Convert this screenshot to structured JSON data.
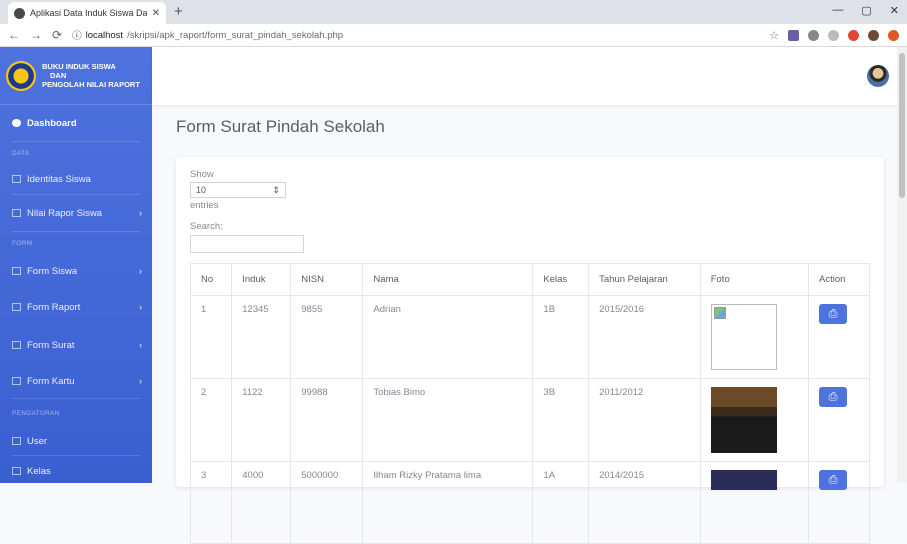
{
  "browser": {
    "tab_title": "Aplikasi Data Induk Siswa Dan Ni",
    "url_host": "localhost",
    "url_path": "/skripsi/apk_raport/form_surat_pindah_sekolah.php"
  },
  "sidebar": {
    "brand_line1": "BUKU INDUK SISWA",
    "brand_line2": "DAN",
    "brand_line3": "PENGOLAH NILAI RAPORT",
    "dashboard": "Dashboard",
    "section_data": "DATA",
    "identitas": "Identitas Siswa",
    "nilai": "Nilai Rapor Siswa",
    "section_form": "FORM",
    "form_siswa": "Form Siswa",
    "form_raport": "Form Raport",
    "form_surat": "Form Surat",
    "form_kartu": "Form Kartu",
    "section_pengaturan": "PENGATURAN",
    "user": "User",
    "kelas": "Kelas"
  },
  "main": {
    "page_title": "Form Surat Pindah Sekolah",
    "show_label": "Show",
    "entries_value": "10",
    "entries_label": "entries",
    "search_label": "Search:"
  },
  "table": {
    "headers": [
      "No",
      "Induk",
      "NISN",
      "Nama",
      "Kelas",
      "Tahun Pelajaran",
      "Foto",
      "Action"
    ],
    "rows": [
      {
        "no": "1",
        "induk": "12345",
        "nisn": "9855",
        "nama": "Adrian",
        "kelas": "1B",
        "tahun": "2015/2016"
      },
      {
        "no": "2",
        "induk": "1122",
        "nisn": "99988",
        "nama": "Tobias Bimo",
        "kelas": "3B",
        "tahun": "2011/2012"
      },
      {
        "no": "3",
        "induk": "4000",
        "nisn": "5000000",
        "nama": "Ilham Rizky Pratama lima",
        "kelas": "1A",
        "tahun": "2014/2015"
      }
    ]
  }
}
